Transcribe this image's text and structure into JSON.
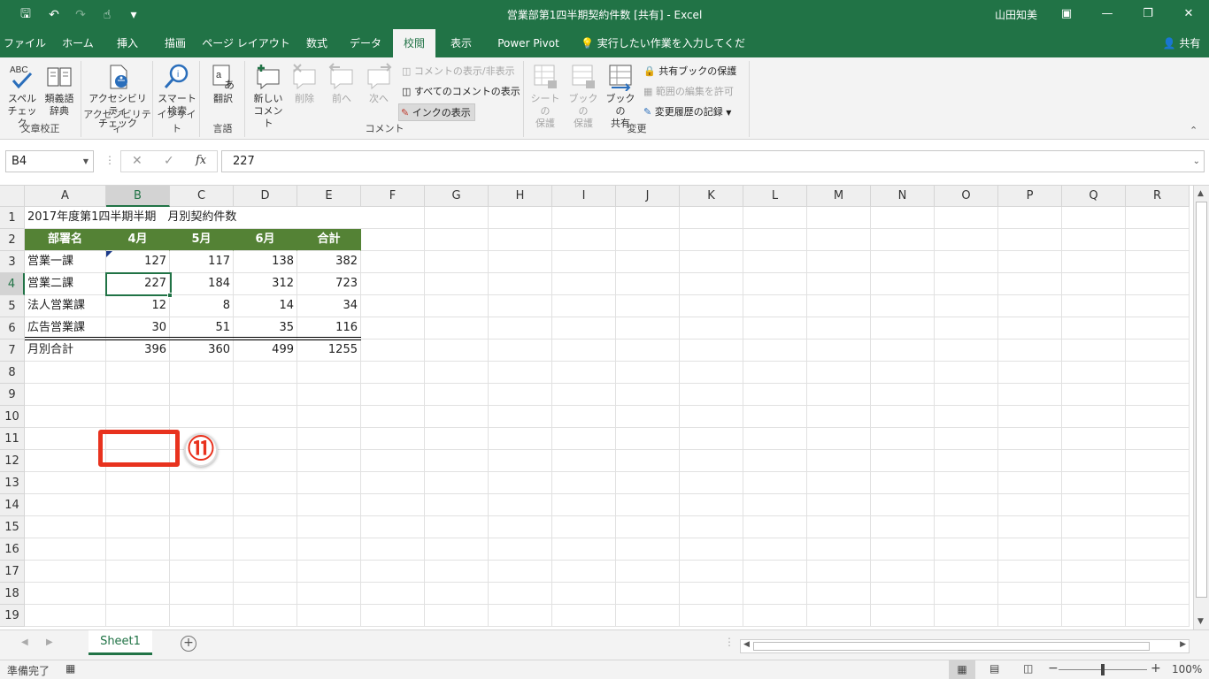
{
  "window": {
    "title": "営業部第1四半期契約件数  [共有]  -  Excel",
    "user": "山田知美"
  },
  "tabs": [
    "ファイル",
    "ホーム",
    "挿入",
    "描画",
    "ページ レイアウト",
    "数式",
    "データ",
    "校閲",
    "表示",
    "Power Pivot"
  ],
  "active_tab": "校閲",
  "tell_me": "実行したい作業を入力してください",
  "share_label": "共有",
  "ribbon": {
    "groups": {
      "proofing": "文章校正",
      "accessibility": "アクセシビリティ",
      "insights": "インサイト",
      "language": "言語",
      "comments": "コメント",
      "changes": "変更"
    },
    "spell_check": [
      "スペル",
      "チェック"
    ],
    "thesaurus": [
      "類義語",
      "辞典"
    ],
    "check_accessibility": [
      "アクセシビリティ",
      "チェック"
    ],
    "smart_lookup": [
      "スマート",
      "検索"
    ],
    "translate": "翻訳",
    "new_comment": [
      "新しい",
      "コメント"
    ],
    "delete": "削除",
    "previous": "前へ",
    "next": "次へ",
    "show_hide_comment": "コメントの表示/非表示",
    "show_all_comments": "すべてのコメントの表示",
    "show_ink": "インクの表示",
    "protect_sheet": [
      "シートの",
      "保護"
    ],
    "protect_workbook": [
      "ブックの",
      "保護"
    ],
    "share_workbook": [
      "ブックの",
      "共有"
    ],
    "protect_shared": "共有ブックの保護",
    "allow_edit_ranges": "範囲の編集を許可",
    "track_changes": "変更履歴の記録"
  },
  "formula_bar": {
    "name_box": "B4",
    "fx": "fx",
    "value": "227"
  },
  "columns": [
    "A",
    "B",
    "C",
    "D",
    "E",
    "F",
    "G",
    "H",
    "I",
    "J",
    "K",
    "L",
    "M",
    "N",
    "O",
    "P",
    "Q",
    "R"
  ],
  "rows": [
    "1",
    "2",
    "3",
    "4",
    "5",
    "6",
    "7",
    "8",
    "9",
    "10",
    "11",
    "12",
    "13",
    "14",
    "15",
    "16",
    "17",
    "18",
    "19"
  ],
  "sheet": {
    "title_cell": "2017年度第1四半期半期　月別契約件数",
    "headers": [
      "部署名",
      "4月",
      "5月",
      "6月",
      "合計"
    ],
    "data": [
      [
        "営業一課",
        "127",
        "117",
        "138",
        "382"
      ],
      [
        "営業二課",
        "227",
        "184",
        "312",
        "723"
      ],
      [
        "法人営業課",
        "12",
        "8",
        "14",
        "34"
      ],
      [
        "広告営業課",
        "30",
        "51",
        "35",
        "116"
      ],
      [
        "月別合計",
        "396",
        "360",
        "499",
        "1255"
      ]
    ]
  },
  "annotation": {
    "label": "⑪",
    "color": "#e8321e"
  },
  "sheet_tabs": [
    "Sheet1"
  ],
  "status": {
    "ready": "準備完了",
    "zoom": "100%"
  }
}
